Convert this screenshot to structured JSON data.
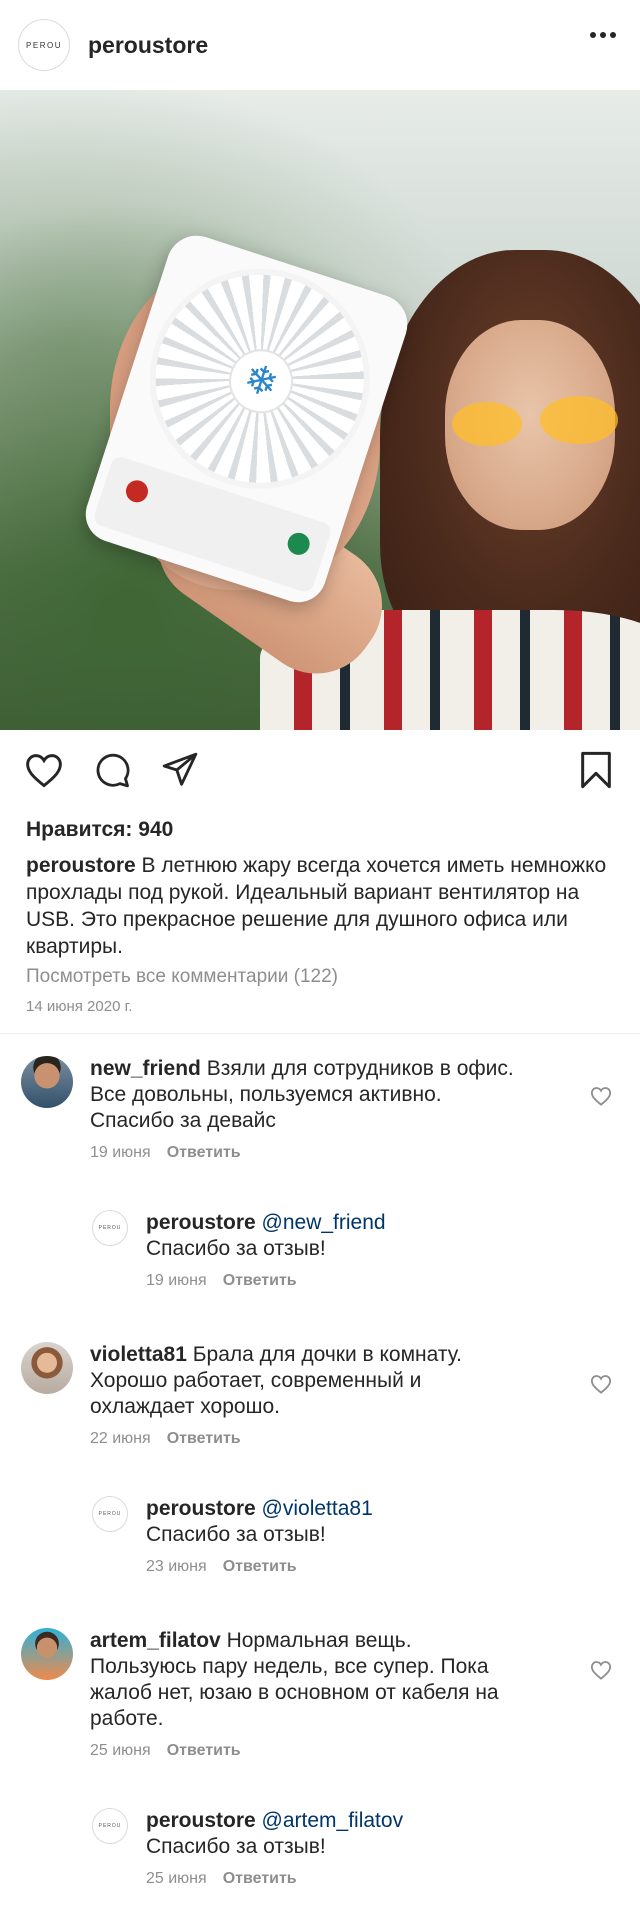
{
  "header": {
    "avatar_text": "PEROU",
    "username": "peroustore",
    "more_icon": "more-horizontal-icon"
  },
  "post": {
    "likes": "Нравится: 940",
    "caption_user": "peroustore",
    "caption_text": "В летнюю жару всегда хочется иметь немножко прохлады под рукой. Идеальный вариант вентилятор на USB. Это прекрасное решение для душного офиса или квартиры.",
    "view_all": "Посмотреть все комментарии (122)",
    "date": "14 июня 2020 г.",
    "icons": [
      "heart-icon",
      "comment-icon",
      "share-icon",
      "bookmark-icon"
    ]
  },
  "comments": [
    {
      "user": "new_friend",
      "text": "Взяли для сотрудников в офис. Все довольны, пользуемся активно. Спасибо за девайс",
      "date": "19 июня",
      "reply_label": "Ответить"
    },
    {
      "user": "peroustore",
      "avatar_text": "PEROU",
      "mention": "@new_friend",
      "text": "Спасибо за отзыв!",
      "date": "19 июня",
      "reply_label": "Ответить"
    },
    {
      "user": "violetta81",
      "text": "Брала для дочки в комнату. Хорошо работает, современный и охлаждает хорошо.",
      "date": "22 июня",
      "reply_label": "Ответить"
    },
    {
      "user": "peroustore",
      "avatar_text": "PEROU",
      "mention": "@violetta81",
      "text": "Спасибо за отзыв!",
      "date": "23 июня",
      "reply_label": "Ответить"
    },
    {
      "user": "artem_filatov",
      "text": "Нормальная вещь. Пользуюсь пару недель, все супер. Пока жалоб нет, юзаю в основном от кабеля на работе.",
      "date": "25 июня",
      "reply_label": "Ответить"
    },
    {
      "user": "peroustore",
      "avatar_text": "PEROU",
      "mention": "@artem_filatov",
      "text": "Спасибо за отзыв!",
      "date": "25 июня",
      "reply_label": "Ответить"
    }
  ],
  "colors": {
    "text": "#262626",
    "muted": "#8e8e8e",
    "mention": "#003569"
  }
}
